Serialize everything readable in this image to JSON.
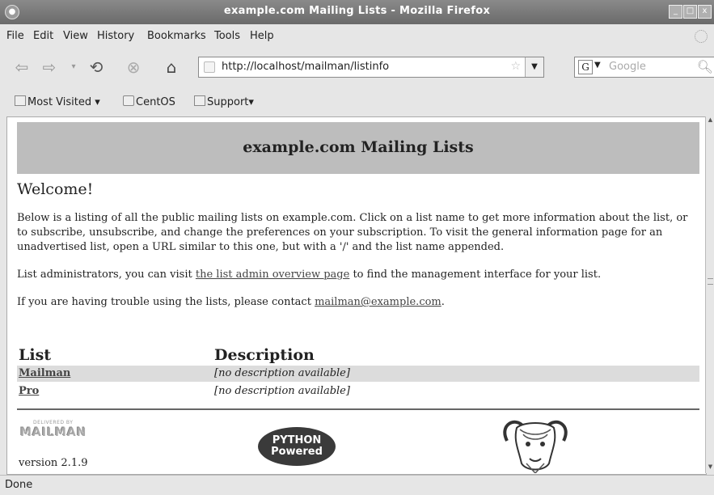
{
  "window": {
    "title": "example.com Mailing Lists - Mozilla Firefox"
  },
  "menu": [
    "File",
    "Edit",
    "View",
    "History",
    "Bookmarks",
    "Tools",
    "Help"
  ],
  "address": {
    "url": "http://localhost/mailman/listinfo"
  },
  "search": {
    "placeholder": "Google",
    "engine_glyph": "G"
  },
  "bookmarks": {
    "most_visited": "Most Visited",
    "centos": "CentOS",
    "support": "Support"
  },
  "page": {
    "banner": "example.com Mailing Lists",
    "welcome": "Welcome!",
    "intro": "Below is a listing of all the public mailing lists on example.com. Click on a list name to get more information about the list, or to subscribe, unsubscribe, and change the preferences on your subscription. To visit the general information page for an unadvertised list, open a URL similar to this one, but with a '/' and the list name appended.",
    "admin_prefix": "List administrators, you can visit ",
    "admin_link": "the list admin overview page",
    "admin_suffix": " to find the management interface for your list.",
    "contact_prefix": "If you are having trouble using the lists, please contact ",
    "contact_link": "mailman@example.com",
    "contact_suffix": ".",
    "table": {
      "col_list": "List",
      "col_description": "Description",
      "rows": [
        {
          "name": "Mailman",
          "description": "[no description available]"
        },
        {
          "name": "Pro",
          "description": "[no description available]"
        }
      ]
    },
    "footer": {
      "mailman_small": "DELIVERED BY",
      "mailman_big": "MAILMAN",
      "version": "version 2.1.9",
      "python_line1": "PYTHON",
      "python_line2": "Powered"
    }
  },
  "status": {
    "text": "Done"
  },
  "colors": {
    "banner_bg": "#bdbdbd",
    "row_highlight": "#dcdcdc",
    "titlebar": "#7a7a7a"
  }
}
